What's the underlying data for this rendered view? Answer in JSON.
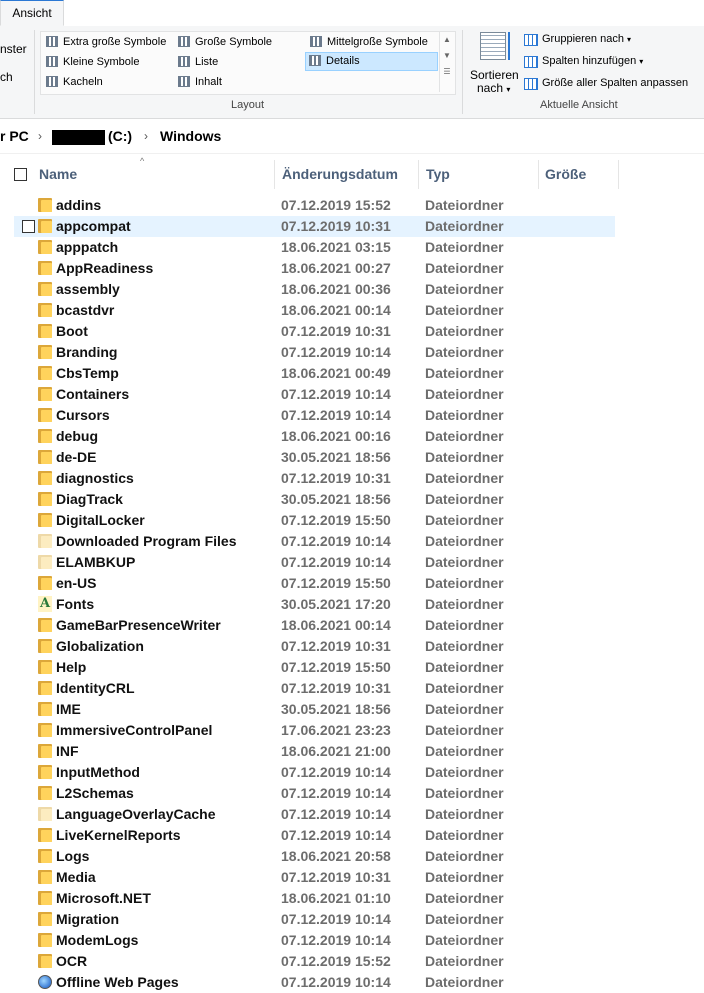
{
  "ribbon": {
    "tab_ansicht": "Ansicht",
    "left_partial": {
      "line1": "nster",
      "line2": "ch"
    },
    "layout": {
      "items": [
        {
          "label": "Extra große Symbole",
          "selected": false
        },
        {
          "label": "Große Symbole",
          "selected": false
        },
        {
          "label": "Mittelgroße Symbole",
          "selected": false
        },
        {
          "label": "Kleine Symbole",
          "selected": false
        },
        {
          "label": "Liste",
          "selected": false
        },
        {
          "label": "Details",
          "selected": true
        },
        {
          "label": "Kacheln",
          "selected": false
        },
        {
          "label": "Inhalt",
          "selected": false
        }
      ],
      "group_label": "Layout"
    },
    "current_view": {
      "sort_line1": "Sortieren",
      "sort_line2": "nach",
      "group_by": "Gruppieren nach",
      "add_columns": "Spalten hinzufügen",
      "fit_columns": "Größe aller Spalten anpassen",
      "group_label": "Aktuelle Ansicht"
    }
  },
  "address": {
    "this_pc": "r PC",
    "drive": "(C:)",
    "folder": "Windows"
  },
  "columns": {
    "name": "Name",
    "date": "Änderungsdatum",
    "type": "Typ",
    "size": "Größe"
  },
  "files": [
    {
      "name": "addins",
      "date": "07.12.2019 15:52",
      "type": "Dateiordner",
      "icon": "folder-icon"
    },
    {
      "name": "appcompat",
      "date": "07.12.2019 10:31",
      "type": "Dateiordner",
      "icon": "folder-icon",
      "hover": true
    },
    {
      "name": "apppatch",
      "date": "18.06.2021 03:15",
      "type": "Dateiordner",
      "icon": "folder-icon"
    },
    {
      "name": "AppReadiness",
      "date": "18.06.2021 00:27",
      "type": "Dateiordner",
      "icon": "folder-icon"
    },
    {
      "name": "assembly",
      "date": "18.06.2021 00:36",
      "type": "Dateiordner",
      "icon": "folder-icon"
    },
    {
      "name": "bcastdvr",
      "date": "18.06.2021 00:14",
      "type": "Dateiordner",
      "icon": "folder-icon"
    },
    {
      "name": "Boot",
      "date": "07.12.2019 10:31",
      "type": "Dateiordner",
      "icon": "folder-icon"
    },
    {
      "name": "Branding",
      "date": "07.12.2019 10:14",
      "type": "Dateiordner",
      "icon": "folder-icon"
    },
    {
      "name": "CbsTemp",
      "date": "18.06.2021 00:49",
      "type": "Dateiordner",
      "icon": "folder-icon"
    },
    {
      "name": "Containers",
      "date": "07.12.2019 10:14",
      "type": "Dateiordner",
      "icon": "folder-icon"
    },
    {
      "name": "Cursors",
      "date": "07.12.2019 10:14",
      "type": "Dateiordner",
      "icon": "folder-icon"
    },
    {
      "name": "debug",
      "date": "18.06.2021 00:16",
      "type": "Dateiordner",
      "icon": "folder-icon"
    },
    {
      "name": "de-DE",
      "date": "30.05.2021 18:56",
      "type": "Dateiordner",
      "icon": "folder-icon"
    },
    {
      "name": "diagnostics",
      "date": "07.12.2019 10:31",
      "type": "Dateiordner",
      "icon": "folder-icon"
    },
    {
      "name": "DiagTrack",
      "date": "30.05.2021 18:56",
      "type": "Dateiordner",
      "icon": "folder-icon"
    },
    {
      "name": "DigitalLocker",
      "date": "07.12.2019 15:50",
      "type": "Dateiordner",
      "icon": "folder-icon"
    },
    {
      "name": "Downloaded Program Files",
      "date": "07.12.2019 10:14",
      "type": "Dateiordner",
      "icon": "folder-icon-pale"
    },
    {
      "name": "ELAMBKUP",
      "date": "07.12.2019 10:14",
      "type": "Dateiordner",
      "icon": "folder-icon-pale"
    },
    {
      "name": "en-US",
      "date": "07.12.2019 15:50",
      "type": "Dateiordner",
      "icon": "folder-icon"
    },
    {
      "name": "Fonts",
      "date": "30.05.2021 17:20",
      "type": "Dateiordner",
      "icon": "fonts-icon"
    },
    {
      "name": "GameBarPresenceWriter",
      "date": "18.06.2021 00:14",
      "type": "Dateiordner",
      "icon": "folder-icon"
    },
    {
      "name": "Globalization",
      "date": "07.12.2019 10:31",
      "type": "Dateiordner",
      "icon": "folder-icon"
    },
    {
      "name": "Help",
      "date": "07.12.2019 15:50",
      "type": "Dateiordner",
      "icon": "folder-icon"
    },
    {
      "name": "IdentityCRL",
      "date": "07.12.2019 10:31",
      "type": "Dateiordner",
      "icon": "folder-icon"
    },
    {
      "name": "IME",
      "date": "30.05.2021 18:56",
      "type": "Dateiordner",
      "icon": "folder-icon"
    },
    {
      "name": "ImmersiveControlPanel",
      "date": "17.06.2021 23:23",
      "type": "Dateiordner",
      "icon": "folder-icon"
    },
    {
      "name": "INF",
      "date": "18.06.2021 21:00",
      "type": "Dateiordner",
      "icon": "folder-icon"
    },
    {
      "name": "InputMethod",
      "date": "07.12.2019 10:14",
      "type": "Dateiordner",
      "icon": "folder-icon"
    },
    {
      "name": "L2Schemas",
      "date": "07.12.2019 10:14",
      "type": "Dateiordner",
      "icon": "folder-icon"
    },
    {
      "name": "LanguageOverlayCache",
      "date": "07.12.2019 10:14",
      "type": "Dateiordner",
      "icon": "folder-icon-pale"
    },
    {
      "name": "LiveKernelReports",
      "date": "07.12.2019 10:14",
      "type": "Dateiordner",
      "icon": "folder-icon"
    },
    {
      "name": "Logs",
      "date": "18.06.2021 20:58",
      "type": "Dateiordner",
      "icon": "folder-icon"
    },
    {
      "name": "Media",
      "date": "07.12.2019 10:31",
      "type": "Dateiordner",
      "icon": "folder-icon"
    },
    {
      "name": "Microsoft.NET",
      "date": "18.06.2021 01:10",
      "type": "Dateiordner",
      "icon": "folder-icon"
    },
    {
      "name": "Migration",
      "date": "07.12.2019 10:14",
      "type": "Dateiordner",
      "icon": "folder-icon"
    },
    {
      "name": "ModemLogs",
      "date": "07.12.2019 10:14",
      "type": "Dateiordner",
      "icon": "folder-icon"
    },
    {
      "name": "OCR",
      "date": "07.12.2019 15:52",
      "type": "Dateiordner",
      "icon": "folder-icon"
    },
    {
      "name": "Offline Web Pages",
      "date": "07.12.2019 10:14",
      "type": "Dateiordner",
      "icon": "web-folder-icon"
    }
  ]
}
